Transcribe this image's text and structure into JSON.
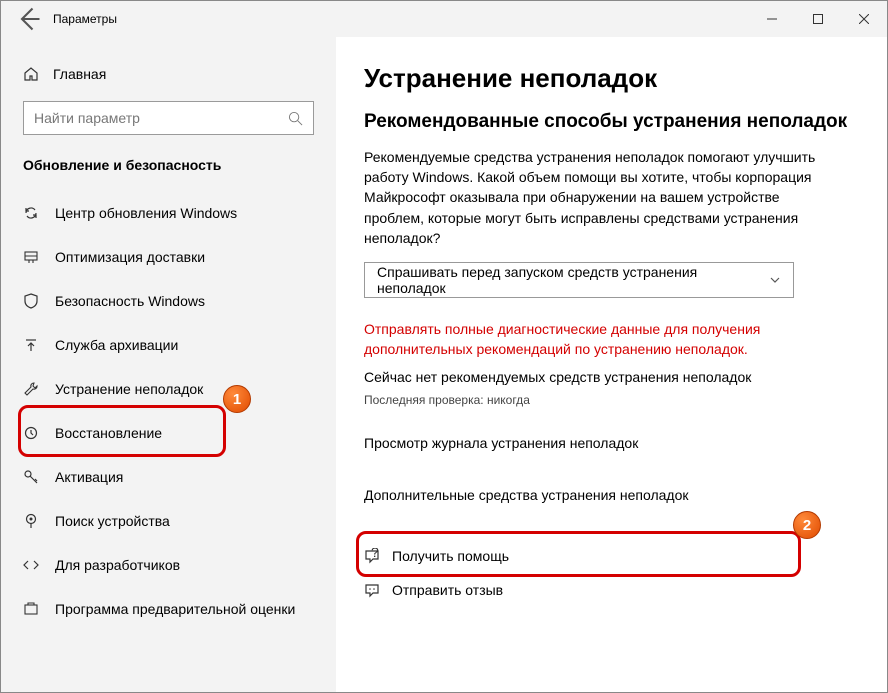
{
  "window": {
    "title": "Параметры"
  },
  "sidebar": {
    "home": "Главная",
    "search_placeholder": "Найти параметр",
    "section": "Обновление и безопасность",
    "items": [
      {
        "label": "Центр обновления Windows"
      },
      {
        "label": "Оптимизация доставки"
      },
      {
        "label": "Безопасность Windows"
      },
      {
        "label": "Служба архивации"
      },
      {
        "label": "Устранение неполадок"
      },
      {
        "label": "Восстановление"
      },
      {
        "label": "Активация"
      },
      {
        "label": "Поиск устройства"
      },
      {
        "label": "Для разработчиков"
      },
      {
        "label": "Программа предварительной оценки"
      }
    ]
  },
  "main": {
    "title": "Устранение неполадок",
    "subtitle": "Рекомендованные способы устранения неполадок",
    "description": "Рекомендуемые средства устранения неполадок помогают улучшить работу Windows. Какой объем помощи вы хотите, чтобы корпорация Майкрософт оказывала при обнаружении на вашем устройстве проблем, которые могут быть исправлены средствами устранения неполадок?",
    "dropdown": "Спрашивать перед запуском средств устранения неполадок",
    "warning": "Отправлять полные диагностические данные для получения дополнительных рекомендаций по устранению неполадок.",
    "status": "Сейчас нет рекомендуемых средств устранения неполадок",
    "last_check": "Последняя проверка: никогда",
    "history_link": "Просмотр журнала устранения неполадок",
    "additional_link": "Дополнительные средства устранения неполадок",
    "help": "Получить помощь",
    "feedback": "Отправить отзыв"
  },
  "annotations": {
    "badge1": "1",
    "badge2": "2"
  }
}
